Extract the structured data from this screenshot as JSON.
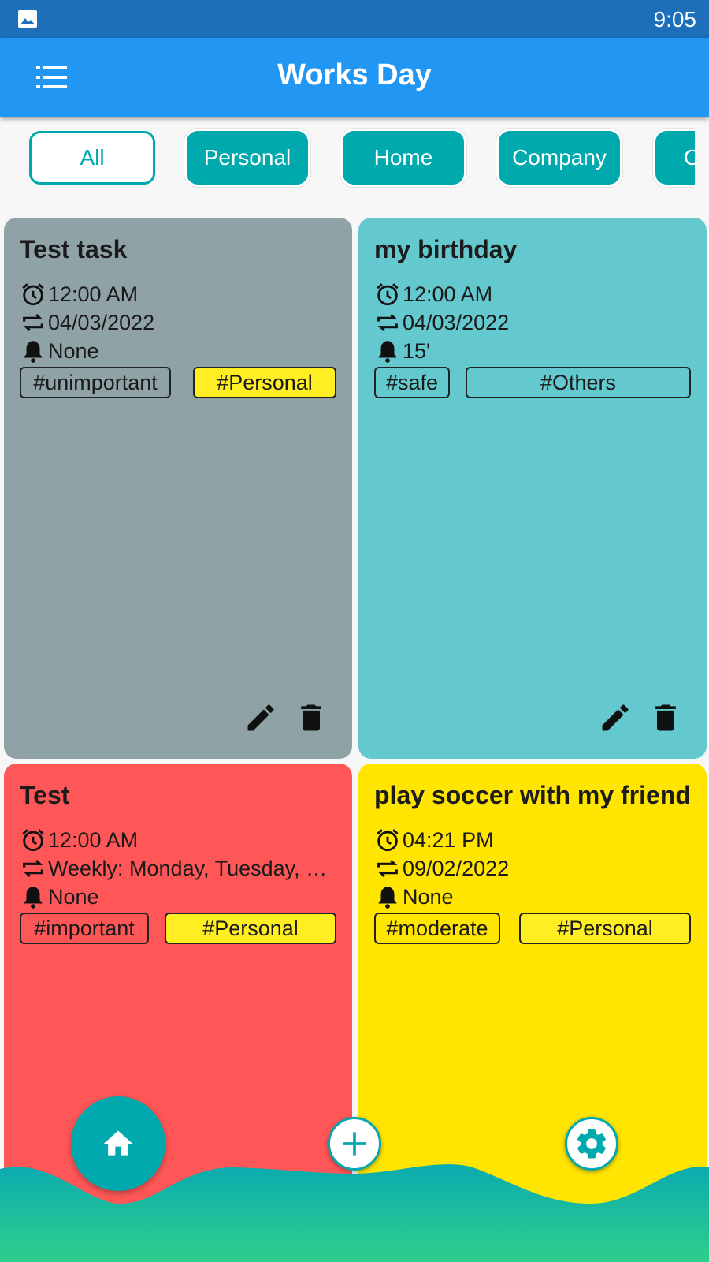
{
  "status_bar": {
    "time": "9:05"
  },
  "app_bar": {
    "title": "Works Day",
    "menu_icon": "list-icon"
  },
  "filters": [
    {
      "label": "All",
      "selected": true
    },
    {
      "label": "Personal",
      "selected": false
    },
    {
      "label": "Home",
      "selected": false
    },
    {
      "label": "Company",
      "selected": false
    },
    {
      "label": "O",
      "selected": false
    }
  ],
  "tasks": [
    {
      "title": "Test task",
      "color": "#8fa2a6",
      "time": "12:00 AM",
      "repeat": "04/03/2022",
      "reminder": "None",
      "priority_tag": "#unimportant",
      "category_tag": "#Personal",
      "category_tag_highlight": true
    },
    {
      "title": "my birthday",
      "color": "#64c9ce",
      "time": "12:00 AM",
      "repeat": "04/03/2022",
      "reminder": "15'",
      "priority_tag": "#safe",
      "category_tag": "#Others",
      "category_tag_highlight": false
    },
    {
      "title": "Test",
      "color": "#ff5757",
      "time": "12:00 AM",
      "repeat": "Weekly: Monday, Tuesday, …",
      "reminder": "None",
      "priority_tag": "#important",
      "category_tag": "#Personal",
      "category_tag_highlight": true
    },
    {
      "title": "play soccer with my friend",
      "color": "#ffe500",
      "time": "04:21 PM",
      "repeat": "09/02/2022",
      "reminder": "None",
      "priority_tag": "#moderate",
      "category_tag": "#Personal",
      "category_tag_highlight": true
    }
  ],
  "bottom_nav": {
    "home_icon": "home-icon",
    "add_icon": "plus-icon",
    "settings_icon": "gear-icon"
  },
  "colors": {
    "status_bar": "#1c6fb8",
    "app_bar": "#2196f3",
    "accent": "#00a9ad",
    "wave_top": "#0aaab0",
    "wave_bottom": "#2ecf8a"
  }
}
